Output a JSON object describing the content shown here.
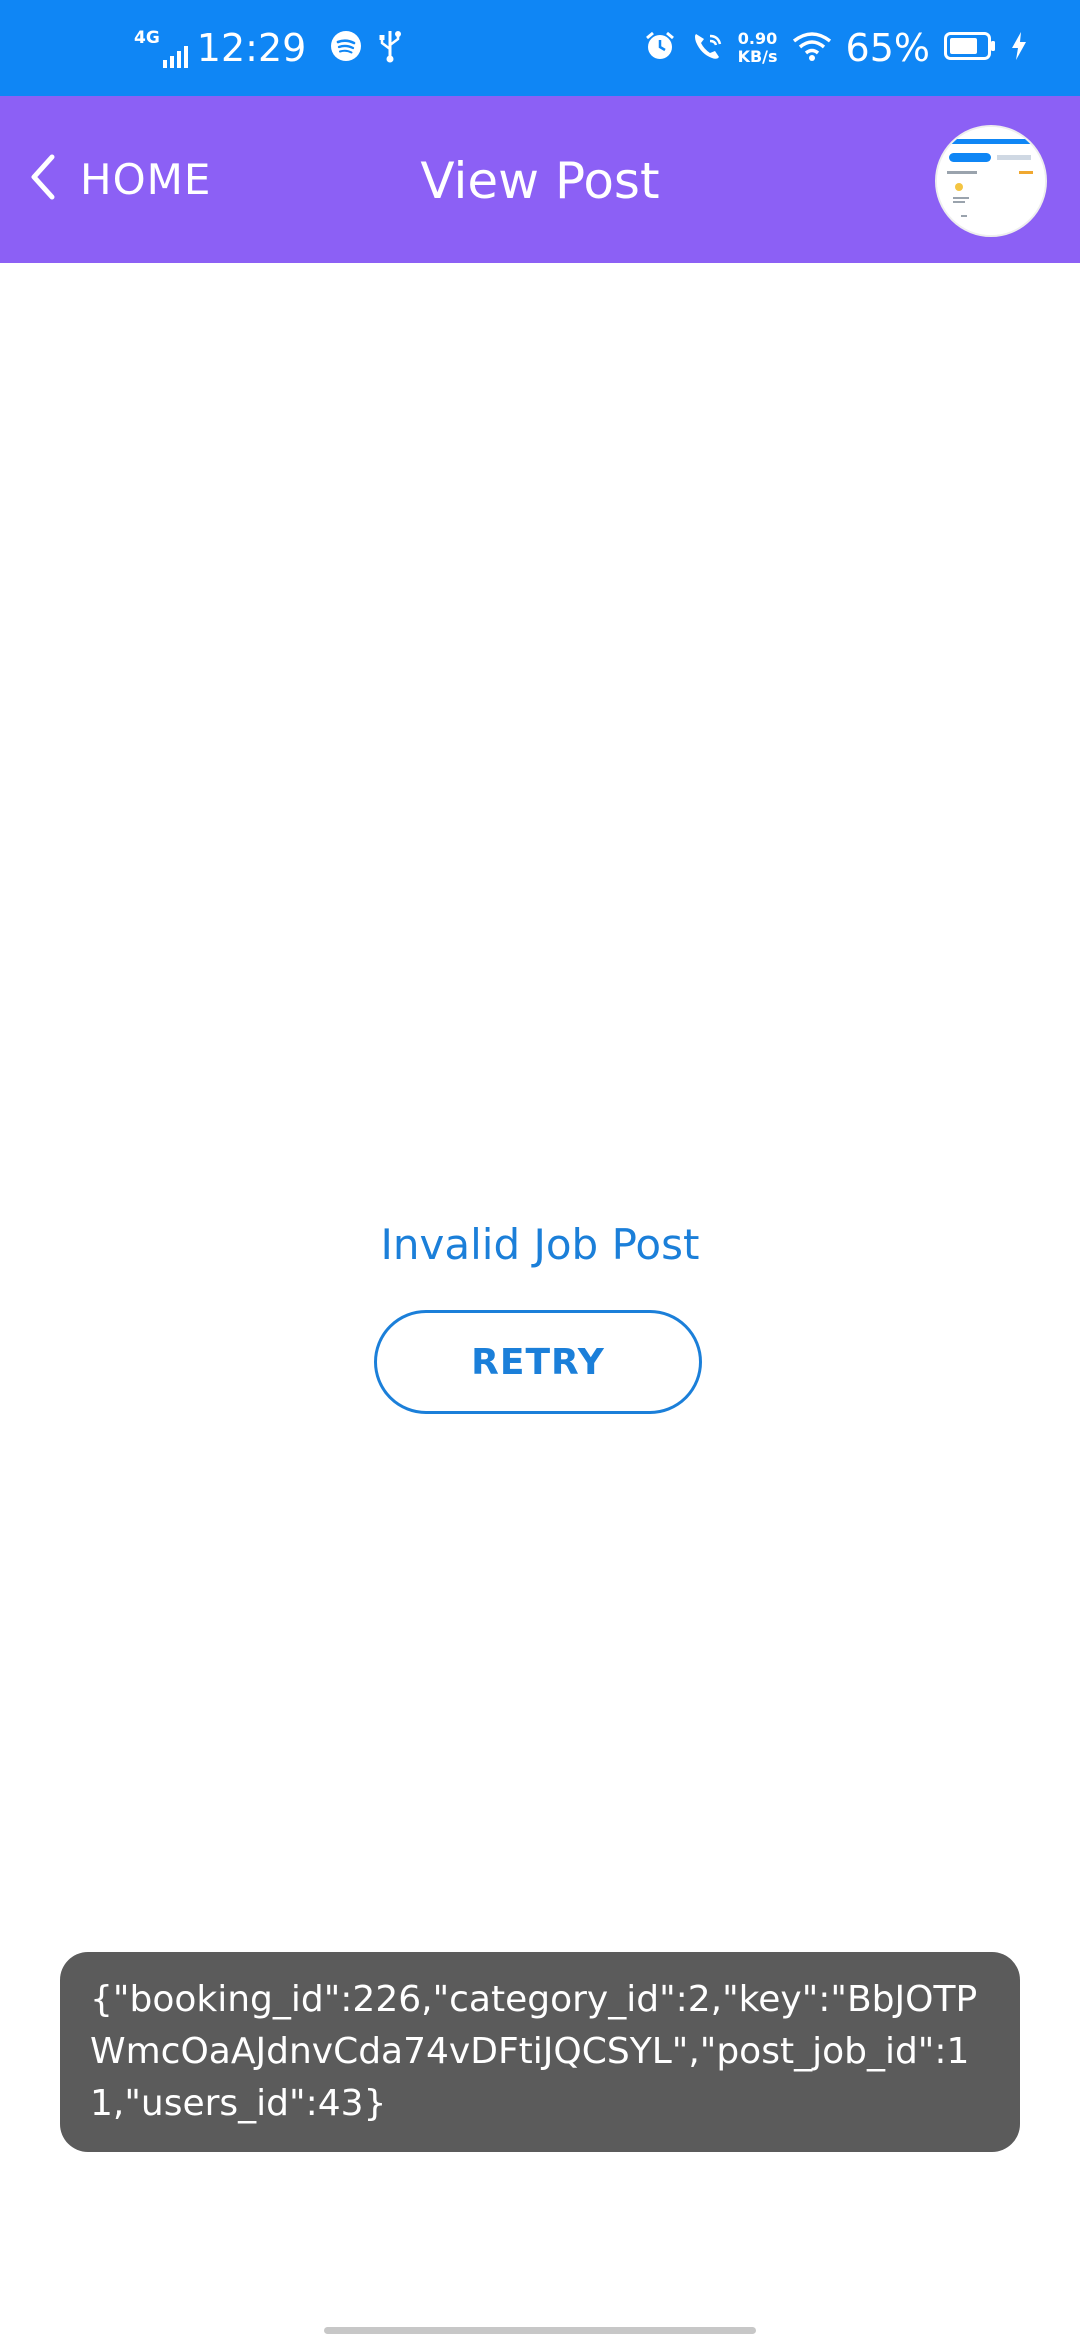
{
  "status_bar": {
    "network": "4G",
    "time": "12:29",
    "speed_value": "0.90",
    "speed_unit": "KB/s",
    "battery": "65%",
    "icons": [
      "signal-icon",
      "spotify-icon",
      "usb-icon",
      "alarm-icon",
      "wifi-call-icon",
      "wifi-icon",
      "battery-icon",
      "charging-icon"
    ]
  },
  "header": {
    "back_label": "HOME",
    "title": "View Post",
    "background": "#8c60f5"
  },
  "content": {
    "message": "Invalid Job Post",
    "retry_label": "RETRY",
    "accent": "#1b7fd9"
  },
  "toast": {
    "text": "{\"booking_id\":226,\"category_id\":2,\"key\":\"BbJOTPWmcOaAJdnvCda74vDFtiJQCSYL\",\"post_job_id\":11,\"users_id\":43}"
  }
}
